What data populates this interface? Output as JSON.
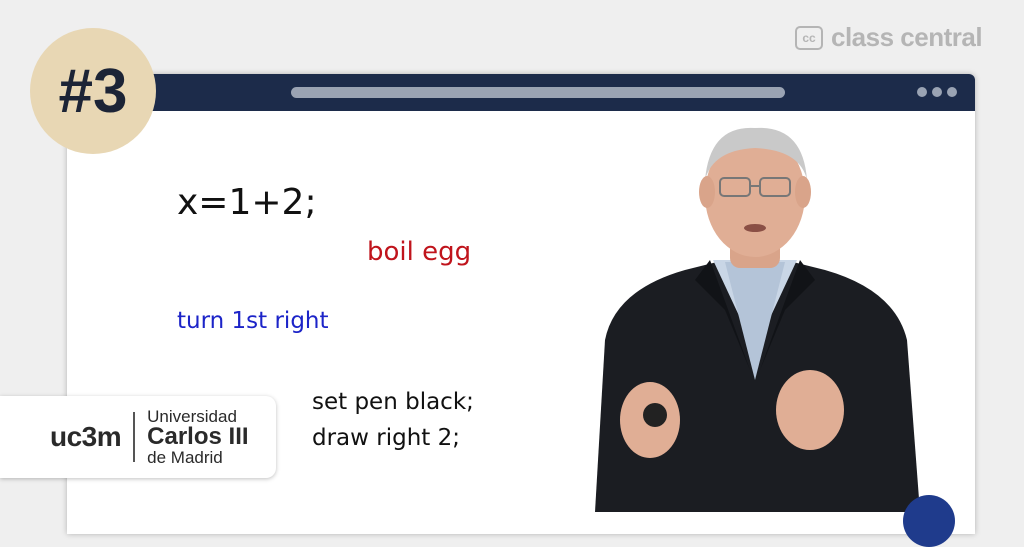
{
  "brand": {
    "icon_text": "cc",
    "name": "class central"
  },
  "badge": {
    "label": "#3"
  },
  "slide": {
    "line1": "x=1+2;",
    "line2": "boil egg",
    "line3": "turn 1st right",
    "line4": "set pen black;",
    "line5": "draw right 2;"
  },
  "logo": {
    "short": "uc3m",
    "line1": "Universidad",
    "line2": "Carlos III",
    "line3": "de Madrid"
  },
  "colors": {
    "titlebar": "#1c2b4a",
    "badge": "#e8d7b4",
    "red_text": "#c0141c",
    "blue_text": "#1c24c8"
  }
}
